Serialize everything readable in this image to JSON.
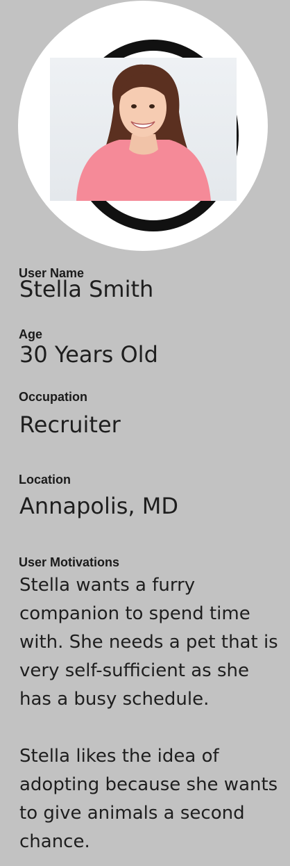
{
  "profile": {
    "photo_icon": "person-photo",
    "fields": {
      "username": {
        "label": "User Name",
        "value": "Stella Smith"
      },
      "age": {
        "label": "Age",
        "value": "30 Years Old"
      },
      "occupation": {
        "label": "Occupation",
        "value": "Recruiter"
      },
      "location": {
        "label": "Location",
        "value": "Annapolis, MD"
      }
    },
    "motivations": {
      "label": "User Motivations",
      "paragraphs": [
        "Stella wants a furry companion to spend time with. She needs a pet that is very self-sufficient as she has a busy schedule.",
        "Stella likes the idea of adopting because she wants to give animals a second chance."
      ]
    }
  },
  "colors": {
    "background": "#c2c2c2",
    "circle": "#ffffff",
    "ring": "#111111",
    "shirt": "#f58a98",
    "hair": "#5b3020"
  }
}
